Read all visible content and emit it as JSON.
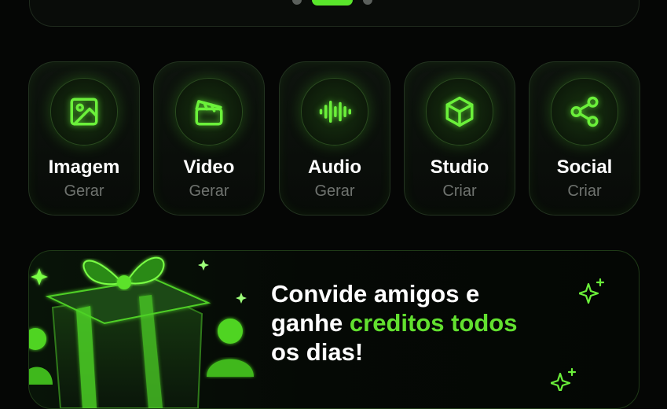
{
  "colors": {
    "accent": "#59e52b",
    "background": "#050605",
    "muted": "#6f736f"
  },
  "carousel": {
    "pages": 3,
    "active_index": 1
  },
  "quick_actions": [
    {
      "label": "Imagem",
      "sub": "Gerar",
      "icon": "image-icon"
    },
    {
      "label": "Video",
      "sub": "Gerar",
      "icon": "clapperboard-icon"
    },
    {
      "label": "Audio",
      "sub": "Gerar",
      "icon": "waveform-icon"
    },
    {
      "label": "Studio",
      "sub": "Criar",
      "icon": "cube-icon"
    },
    {
      "label": "Social",
      "sub": "Criar",
      "icon": "share-icon"
    }
  ],
  "promo": {
    "title_part1": "Convide amigos e",
    "title_part2": "ganhe ",
    "title_accent": "creditos todos",
    "title_part3": "os dias!"
  }
}
